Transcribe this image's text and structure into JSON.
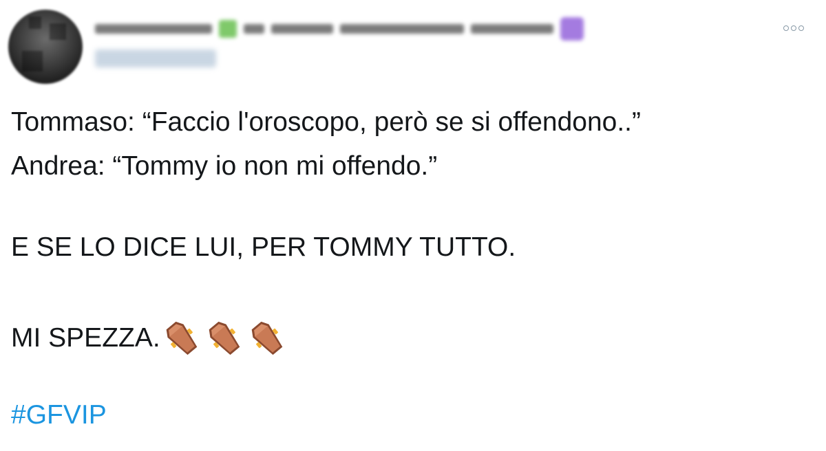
{
  "tweet": {
    "author": {
      "display_name_redacted": true,
      "handle_redacted": true
    },
    "more_menu": {
      "icon": "more-horizontal-icon"
    },
    "body": {
      "line1": "Tommaso: “Faccio l'oroscopo, però se si offendono..”",
      "line2": "Andrea: “Tommy io non mi offendo.”",
      "line3": "E SE LO DICE LUI, PER TOMMY TUTTO.",
      "line4": "MI SPEZZA.",
      "emojis": [
        "coffin-icon",
        "coffin-icon",
        "coffin-icon"
      ]
    },
    "hashtag": "#GFVIP",
    "colors": {
      "text": "#14171a",
      "link": "#1b95e0",
      "coffin_body": "#c97a55",
      "coffin_dark": "#8b4a2f",
      "coffin_handle": "#f2b233"
    }
  }
}
